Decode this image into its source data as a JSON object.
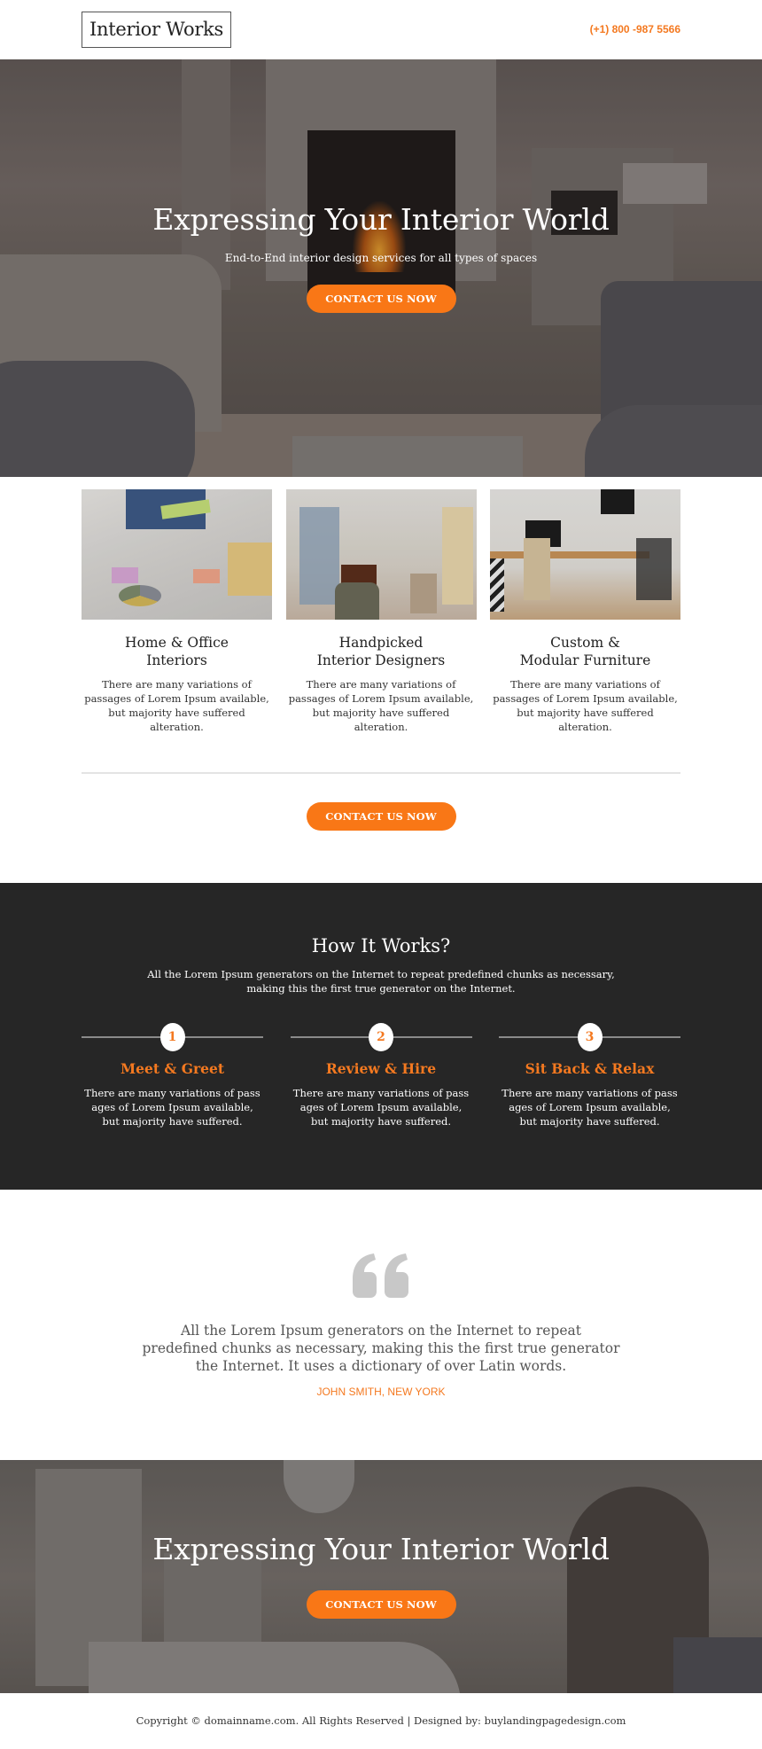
{
  "header": {
    "logo": "Interior Works",
    "phone": "(+1) 800 -987 5566"
  },
  "hero": {
    "title": "Expressing Your Interior World",
    "subtitle": "End-to-End interior design services for all types of spaces",
    "cta_label": "CONTACT US NOW"
  },
  "features": {
    "items": [
      {
        "title_line1": "Home & Office",
        "title_line2": "Interiors",
        "text": "There are many variations of passages of Lorem Ipsum available, but majority have suffered alteration.",
        "image": "home-office-desk-photo"
      },
      {
        "title_line1": "Handpicked",
        "title_line2": "Interior Designers",
        "text": "There are many variations of passages of Lorem Ipsum available, but majority have suffered alteration.",
        "image": "study-room-photo"
      },
      {
        "title_line1": "Custom &",
        "title_line2": "Modular Furniture",
        "text": "There are many variations of passages of Lorem Ipsum available, but majority have suffered alteration.",
        "image": "modular-workspace-photo"
      }
    ],
    "cta_label": "CONTACT US NOW"
  },
  "how": {
    "title": "How It Works?",
    "subtitle": "All the Lorem Ipsum generators on the Internet to repeat predefined chunks as necessary, making this the first true generator on the Internet.",
    "steps": [
      {
        "number": "1",
        "title": "Meet & Greet",
        "text": "There are many variations of pass ages of Lorem Ipsum available, but majority have suffered."
      },
      {
        "number": "2",
        "title": "Review & Hire",
        "text": "There are many variations of pass ages of Lorem Ipsum available, but majority have suffered."
      },
      {
        "number": "3",
        "title": "Sit Back & Relax",
        "text": "There are many variations of pass ages of Lorem Ipsum available, but majority have suffered."
      }
    ]
  },
  "testimonial": {
    "icon": "quote-icon",
    "text": "All the Lorem Ipsum generators on the Internet to repeat predefined chunks as necessary, making this the first true generator the Internet. It uses a dictionary of over Latin words.",
    "author": "JOHN SMITH, NEW YORK"
  },
  "cta_banner": {
    "title": "Expressing Your Interior World",
    "cta_label": "CONTACT US NOW"
  },
  "footer": {
    "text": "Copyright © domainname.com. All Rights Reserved | Designed by: buylandingpagedesign.com"
  },
  "colors": {
    "accent": "#f97716",
    "accent_text": "#f47920",
    "dark_section": "#262626"
  }
}
